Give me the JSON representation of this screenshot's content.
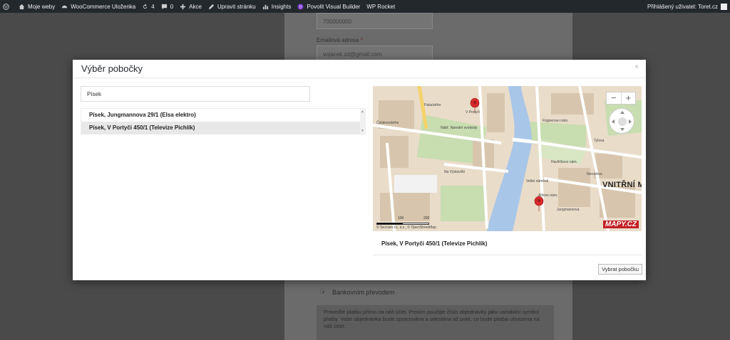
{
  "admin_bar": {
    "items": [
      {
        "icon": "wordpress-icon",
        "label": ""
      },
      {
        "icon": "home-icon",
        "label": "Moje weby"
      },
      {
        "icon": "dashboard-icon",
        "label": "WooCommerce Uloženka"
      },
      {
        "icon": "update-icon",
        "label": "4"
      },
      {
        "icon": "comment-icon",
        "label": "0"
      },
      {
        "icon": "plus-icon",
        "label": "Akce"
      },
      {
        "icon": "pencil-icon",
        "label": "Upravit stránku"
      },
      {
        "icon": "bar-chart-icon",
        "label": "Insights"
      },
      {
        "icon": "divi-icon",
        "label": "Povolit Visual Builder"
      },
      {
        "icon": "",
        "label": "WP Rocket"
      }
    ],
    "user_label": "Přihlášený uživatel: Toret.cz"
  },
  "background_form": {
    "phone_value": "700000000",
    "email_label": "Emailová adresa",
    "email_required": "*",
    "email_value": "vojacek.zd@gmail.com",
    "payment_option": "Bankovním převodem",
    "payment_note": "Proveďte platbu přímo na náš účet. Prosím použijte číslo objednávky jako variabilní symbol platby. Vaše objednávka bude zpracována a odeslána až poté, co bude platba uhrazena na náš účet."
  },
  "modal": {
    "title": "Výběr pobočky",
    "close_label": "×",
    "search": {
      "value": "Písek",
      "placeholder": ""
    },
    "branches": [
      {
        "label": "Písek, Jungmannova 29/1 (Elsa elektro)",
        "selected": false
      },
      {
        "label": "Písek, V Portyči 450/1 (Televize Pichlík)",
        "selected": true
      }
    ],
    "map": {
      "district_label": "VNITŘNÍ M",
      "logo": "MAPY.CZ",
      "scale_labels": [
        "100",
        "200"
      ],
      "copyright": "© Seznam.cz, a.s., © OpenStreetMap",
      "zoom_in": "+",
      "zoom_out": "−",
      "street_labels": [
        "Palackého",
        "Čelakovského",
        "Nábř. Národní svobody",
        "Na Výstavišti",
        "Fügnerovo nám.",
        "Havlíčkovo nám.",
        "Velké náměstí",
        "Alšovo nám.",
        "Jungmannova",
        "Nerudova",
        "Tylova",
        "V Portyči"
      ],
      "colors": {
        "river": "#a8c6e8",
        "park": "#c8ddb0",
        "road": "#ffffff",
        "main_road": "#f5d36b",
        "marker": "#d62b2b"
      }
    },
    "selected_branch": "Písek, V Portyči 450/1 (Televize Pichlík)",
    "select_button": "Vybrat pobočku"
  }
}
